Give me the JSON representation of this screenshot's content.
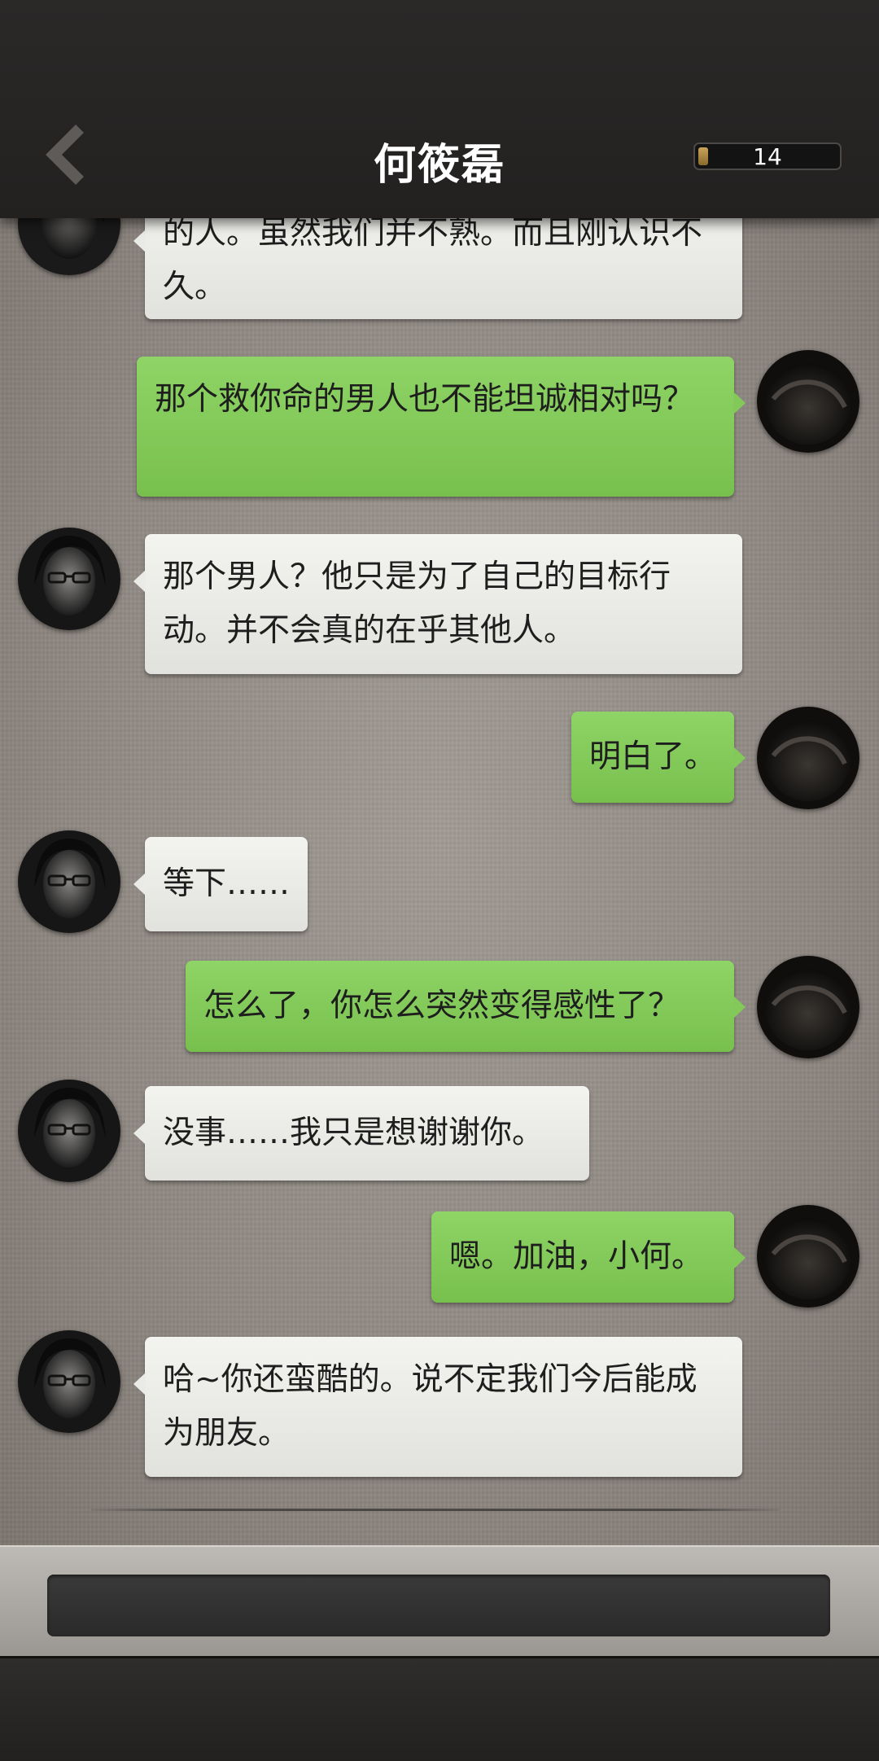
{
  "header": {
    "title": "何筱磊",
    "counter_value": "14",
    "counter_fill_fraction": 0.07,
    "back_icon": "chevron-left-icon"
  },
  "messages": [
    {
      "side": "left",
      "text": "的人。虽然我们并不熟。而且刚认识不久。"
    },
    {
      "side": "right",
      "text": "那个救你命的男人也不能坦诚相对吗？"
    },
    {
      "side": "left",
      "text": "那个男人？他只是为了自己的目标行动。并不会真的在乎其他人。"
    },
    {
      "side": "right",
      "text": "明白了。"
    },
    {
      "side": "left",
      "text": "等下……"
    },
    {
      "side": "right",
      "text": "怎么了，你怎么突然变得感性了？"
    },
    {
      "side": "left",
      "text": "没事……我只是想谢谢你。"
    },
    {
      "side": "right",
      "text": "嗯。加油，小何。"
    },
    {
      "side": "left",
      "text": "哈~你还蛮酷的。说不定我们今后能成为朋友。"
    }
  ],
  "input": {
    "value": ""
  },
  "colors": {
    "header_bg": "#262423",
    "left_bubble": "#ecece8",
    "right_bubble": "#82c95a",
    "chat_bg": "#948d87"
  }
}
